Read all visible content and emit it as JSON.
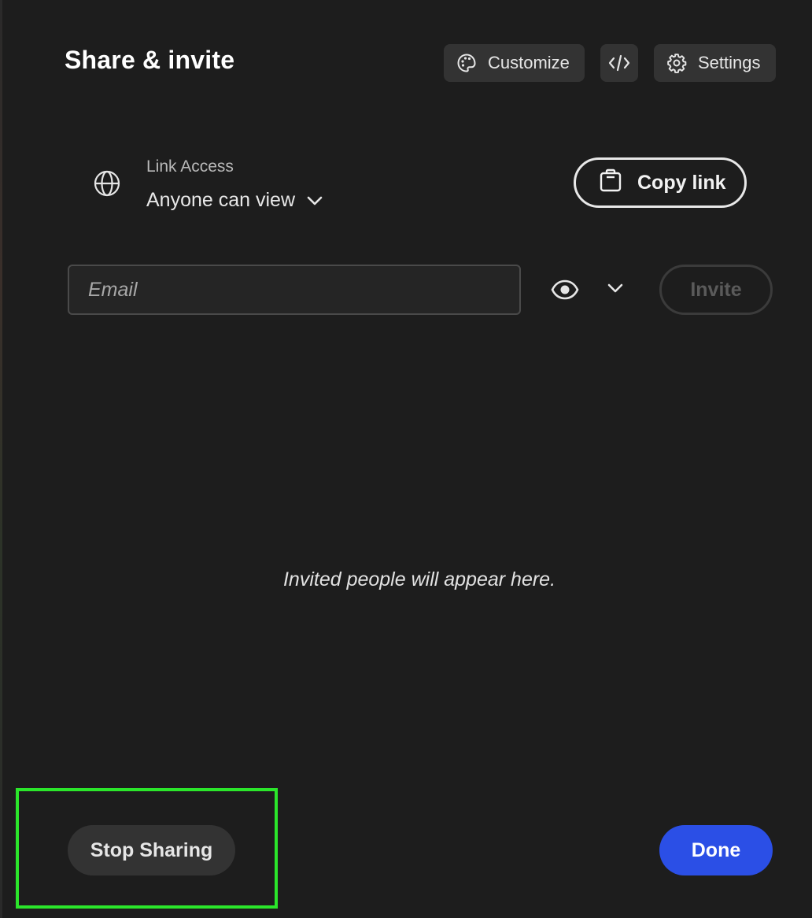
{
  "header": {
    "title": "Share & invite",
    "customize_label": "Customize",
    "settings_label": "Settings",
    "embed_icon": "code-icon",
    "customize_icon": "palette-icon",
    "settings_icon": "gear-icon"
  },
  "link_access": {
    "label": "Link Access",
    "value": "Anyone can view",
    "icon": "globe-icon",
    "copy_label": "Copy link",
    "copy_icon": "clipboard-icon"
  },
  "invite": {
    "email_placeholder": "Email",
    "email_value": "",
    "permission_icon": "eye-icon",
    "invite_label": "Invite",
    "invite_enabled": false
  },
  "empty_state": {
    "message": "Invited people will appear here."
  },
  "footer": {
    "stop_sharing_label": "Stop Sharing",
    "done_label": "Done"
  },
  "colors": {
    "background": "#1d1d1d",
    "primary": "#2b4fe6",
    "highlight": "#2be62b"
  }
}
